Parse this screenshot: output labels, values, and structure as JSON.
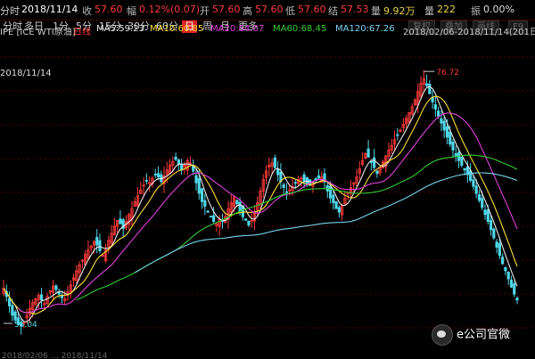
{
  "quote_bar": {
    "time_label": "分时",
    "date": "2018/11/14",
    "close_label": "收",
    "close": "57.60",
    "change_label": "幅",
    "change": "0.12%(0.07)",
    "open_label": "开",
    "open": "57.60",
    "high_label": "高",
    "high": "57.60",
    "low_label": "低",
    "low": "57.60",
    "settle_label": "结",
    "settle": "57.53",
    "volume_label": "量",
    "volume": "9.92万",
    "position_label": "量",
    "position": "222",
    "amplitude_label": "振",
    "amplitude": "0.00%"
  },
  "toolbar": {
    "tabs": [
      {
        "label": "分时",
        "active": false
      },
      {
        "label": "多日",
        "active": false
      },
      {
        "label": "1分",
        "active": false
      },
      {
        "label": "5分",
        "active": false
      },
      {
        "label": "15分",
        "active": false
      },
      {
        "label": "30分",
        "active": false
      },
      {
        "label": "60分",
        "active": false
      },
      {
        "label": "日",
        "active": true
      },
      {
        "label": "周",
        "active": false
      },
      {
        "label": "月",
        "active": false
      },
      {
        "label": "更多",
        "active": false
      }
    ],
    "right_buttons": [
      "复权",
      "叠加",
      "画线",
      "F9"
    ]
  },
  "legend": {
    "symbol": "IPE [ICE WTI原油]",
    "period": "日线",
    "ma5": "MA5:59.23",
    "ma10": "MA10:60.85",
    "ma20": "MA20:64.07",
    "ma60": "MA60:68.45",
    "ma120": "MA120:67.26",
    "range": "2018/02/06-2018/11/14(201日)"
  },
  "colors": {
    "up": "#ff3b3b",
    "down": "#4fd6e8",
    "ma5": "#e8e8e8",
    "ma10": "#ffdd33",
    "ma20": "#e040e0",
    "ma60": "#33cc33",
    "ma120": "#77d4f0",
    "grid": "#5a0000"
  },
  "chart_data": {
    "type": "candlestick",
    "x_range": [
      "2018/02/06",
      "2018/11/14"
    ],
    "ylim": [
      53,
      79
    ],
    "max_label": "76.72",
    "min_label": "55.04",
    "left_ticks": [
      "2018/11/14",
      "2018/11/14"
    ],
    "bottom_text": "2018/02/06 … 2018/11/14",
    "close_series": [
      58.5,
      57.8,
      57.0,
      56.2,
      55.8,
      55.4,
      55.3,
      55.6,
      56.2,
      56.8,
      57.3,
      57.6,
      57.9,
      57.5,
      57.2,
      57.8,
      58.3,
      58.7,
      58.4,
      58.0,
      57.7,
      57.6,
      58.2,
      58.8,
      59.4,
      60.0,
      60.5,
      60.9,
      61.4,
      61.8,
      62.1,
      62.5,
      62.2,
      61.7,
      61.3,
      61.8,
      62.6,
      63.2,
      63.8,
      64.3,
      64.0,
      63.6,
      64.2,
      64.8,
      65.3,
      65.9,
      66.4,
      66.9,
      67.3,
      67.7,
      67.5,
      67.9,
      68.2,
      68.0,
      67.6,
      68.1,
      68.6,
      69.0,
      69.3,
      69.5,
      69.1,
      68.6,
      69.0,
      69.4,
      69.2,
      68.5,
      67.5,
      66.6,
      65.9,
      65.5,
      65.0,
      64.6,
      64.2,
      64.0,
      64.4,
      64.2,
      64.6,
      65.3,
      65.8,
      66.3,
      65.7,
      65.1,
      64.6,
      64.3,
      63.9,
      64.3,
      64.9,
      65.8,
      66.8,
      67.8,
      68.5,
      69.0,
      69.2,
      68.8,
      68.2,
      67.6,
      67.1,
      66.7,
      66.9,
      67.2,
      67.5,
      67.8,
      67.9,
      67.6,
      67.4,
      67.3,
      67.5,
      67.7,
      67.9,
      68.0,
      67.6,
      66.8,
      66.2,
      65.8,
      65.3,
      65.0,
      65.6,
      66.2,
      66.7,
      67.1,
      67.5,
      68.0,
      68.7,
      69.4,
      70.0,
      69.7,
      69.3,
      68.8,
      68.3,
      68.8,
      69.3,
      69.8,
      70.3,
      70.7,
      71.2,
      71.6,
      72.0,
      72.5,
      73.0,
      73.5,
      74.0,
      74.6,
      75.3,
      76.0,
      76.4,
      75.8,
      75.1,
      74.4,
      73.8,
      73.2,
      72.6,
      72.0,
      71.4,
      70.8,
      70.3,
      69.8,
      69.4,
      69.0,
      68.6,
      68.2,
      67.7,
      67.2,
      66.6,
      66.0,
      65.4,
      64.8,
      64.2,
      63.5,
      62.8,
      62.0,
      61.3,
      60.6,
      60.0,
      59.3,
      58.6,
      58.0,
      57.5
    ]
  }
}
